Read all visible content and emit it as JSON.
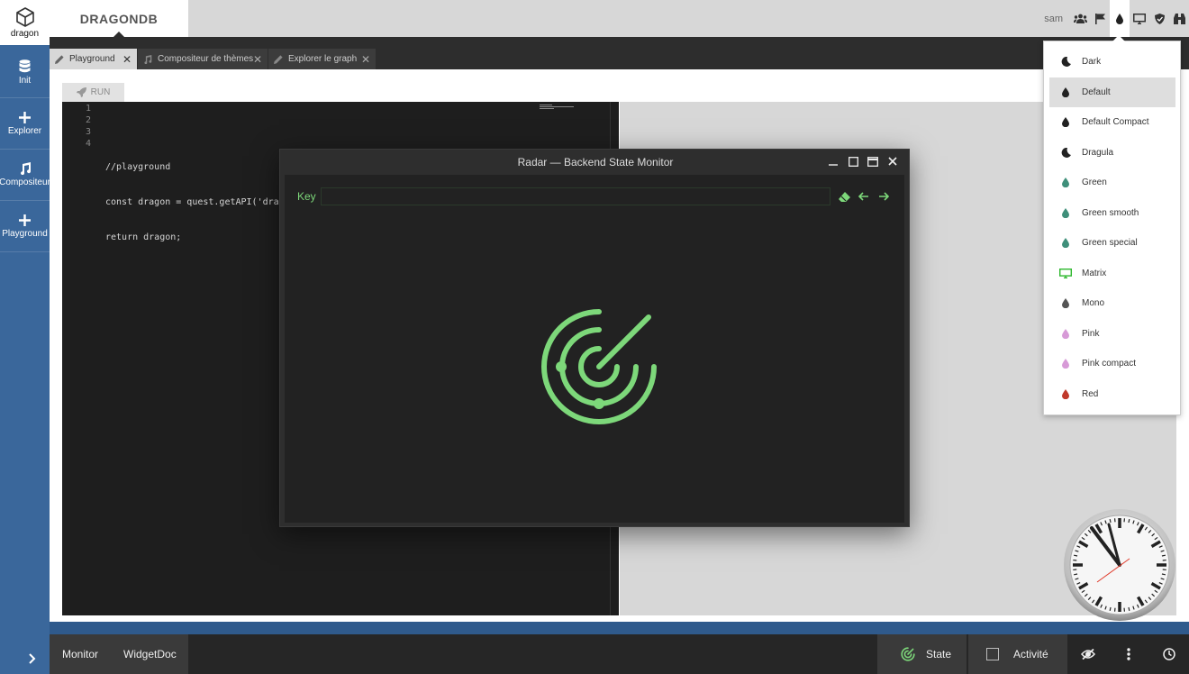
{
  "brand": {
    "logo_text": "dragon",
    "app_title": "DRAGONDB"
  },
  "sidebar": {
    "items": [
      {
        "label": "Init",
        "icon": "database-icon"
      },
      {
        "label": "Explorer",
        "icon": "plus-icon"
      },
      {
        "label": "Compositeur",
        "icon": "music-icon"
      },
      {
        "label": "Playground",
        "icon": "plus-icon"
      }
    ],
    "expand_icon": "chevron-right-icon"
  },
  "topbar": {
    "user": "sam",
    "icons": [
      "users-icon",
      "flag-icon",
      "droplet-icon",
      "monitor-icon",
      "shield-icon",
      "binoculars-icon"
    ]
  },
  "tabs": [
    {
      "label": "Playground",
      "icon": "pencil-icon",
      "active": true
    },
    {
      "label": "Compositeur de thèmes",
      "icon": "music-icon",
      "active": false
    },
    {
      "label": "Explorer le graph",
      "icon": "pencil-icon",
      "active": false
    }
  ],
  "editor": {
    "run_label": "RUN",
    "line_numbers": [
      "1",
      "2",
      "3",
      "4"
    ],
    "code": [
      "",
      "//playground",
      "const dragon = quest.getAPI('dragon');",
      "return dragon;"
    ]
  },
  "dialog": {
    "title": "Radar — Backend State Monitor",
    "key_label": "Key",
    "key_value": "",
    "radar_color": "#7dd87a"
  },
  "theme_menu": {
    "selected": "Default",
    "items": [
      {
        "label": "Dark",
        "icon": "moon-icon",
        "color": "#222222"
      },
      {
        "label": "Default",
        "icon": "droplet-icon",
        "color": "#222222"
      },
      {
        "label": "Default Compact",
        "icon": "droplet-icon",
        "color": "#222222"
      },
      {
        "label": "Dragula",
        "icon": "moon-icon",
        "color": "#222222"
      },
      {
        "label": "Green",
        "icon": "droplet-icon",
        "color": "#3f8f7a"
      },
      {
        "label": "Green smooth",
        "icon": "droplet-icon",
        "color": "#3f8f7a"
      },
      {
        "label": "Green special",
        "icon": "droplet-icon",
        "color": "#3f8f7a"
      },
      {
        "label": "Matrix",
        "icon": "monitor-icon",
        "color": "#2eb82e"
      },
      {
        "label": "Mono",
        "icon": "droplet-icon",
        "color": "#555555"
      },
      {
        "label": "Pink",
        "icon": "droplet-icon",
        "color": "#d79ad7"
      },
      {
        "label": "Pink compact",
        "icon": "droplet-icon",
        "color": "#d79ad7"
      },
      {
        "label": "Red",
        "icon": "droplet-icon",
        "color": "#c0392b"
      }
    ]
  },
  "taskbar": {
    "left_items": [
      "Monitor",
      "WidgetDoc"
    ],
    "state_label": "State",
    "activity_label": "Activité"
  },
  "colors": {
    "sidebar": "#3a679b",
    "accent_green": "#7dd87a",
    "dark_bg": "#2d2d2d"
  }
}
